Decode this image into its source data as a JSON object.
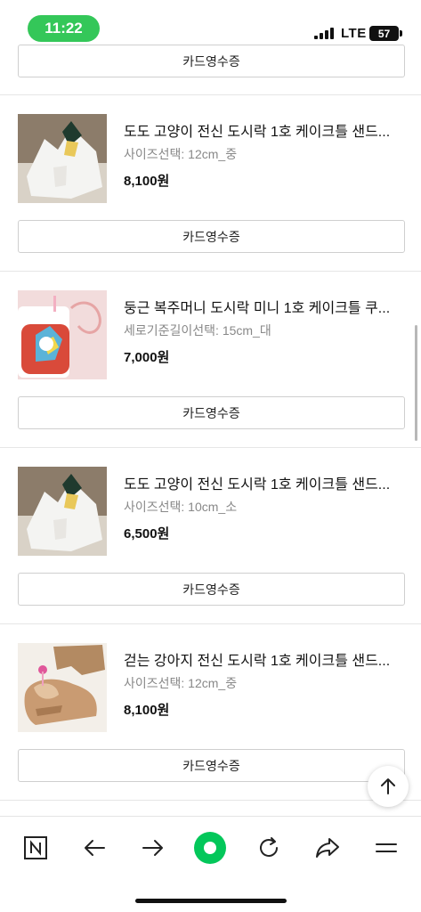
{
  "status_bar": {
    "time": "11:22",
    "network": "LTE",
    "battery": "57"
  },
  "receipt_button_label": "카드영수증",
  "items": [
    {
      "title": "도도 고양이 전신 도시락 1호 케이크틀 샌드...",
      "option": "사이즈선택: 12cm_중",
      "price": "8,100원",
      "thumb_icon": "cat-cake-photo"
    },
    {
      "title": "둥근 복주머니 도시락 미니 1호 케이크틀 쿠...",
      "option": "세로기준길이선택: 15cm_대",
      "price": "7,000원",
      "thumb_icon": "pouch-cake-photo"
    },
    {
      "title": "도도 고양이 전신 도시락 1호 케이크틀 샌드...",
      "option": "사이즈선택: 10cm_소",
      "price": "6,500원",
      "thumb_icon": "cat-cake-photo"
    },
    {
      "title": "걷는 강아지 전신 도시락 1호 케이크틀 샌드...",
      "option": "사이즈선택: 12cm_중",
      "price": "8,100원",
      "thumb_icon": "dog-cake-photo"
    }
  ],
  "bottom_nav": {
    "items": [
      "naver-home-icon",
      "back-arrow-icon",
      "forward-arrow-icon",
      "green-dot-icon",
      "refresh-icon",
      "share-icon",
      "menu-icon"
    ]
  },
  "colors": {
    "status_green": "#34c759",
    "naver_green": "#03c75a"
  }
}
